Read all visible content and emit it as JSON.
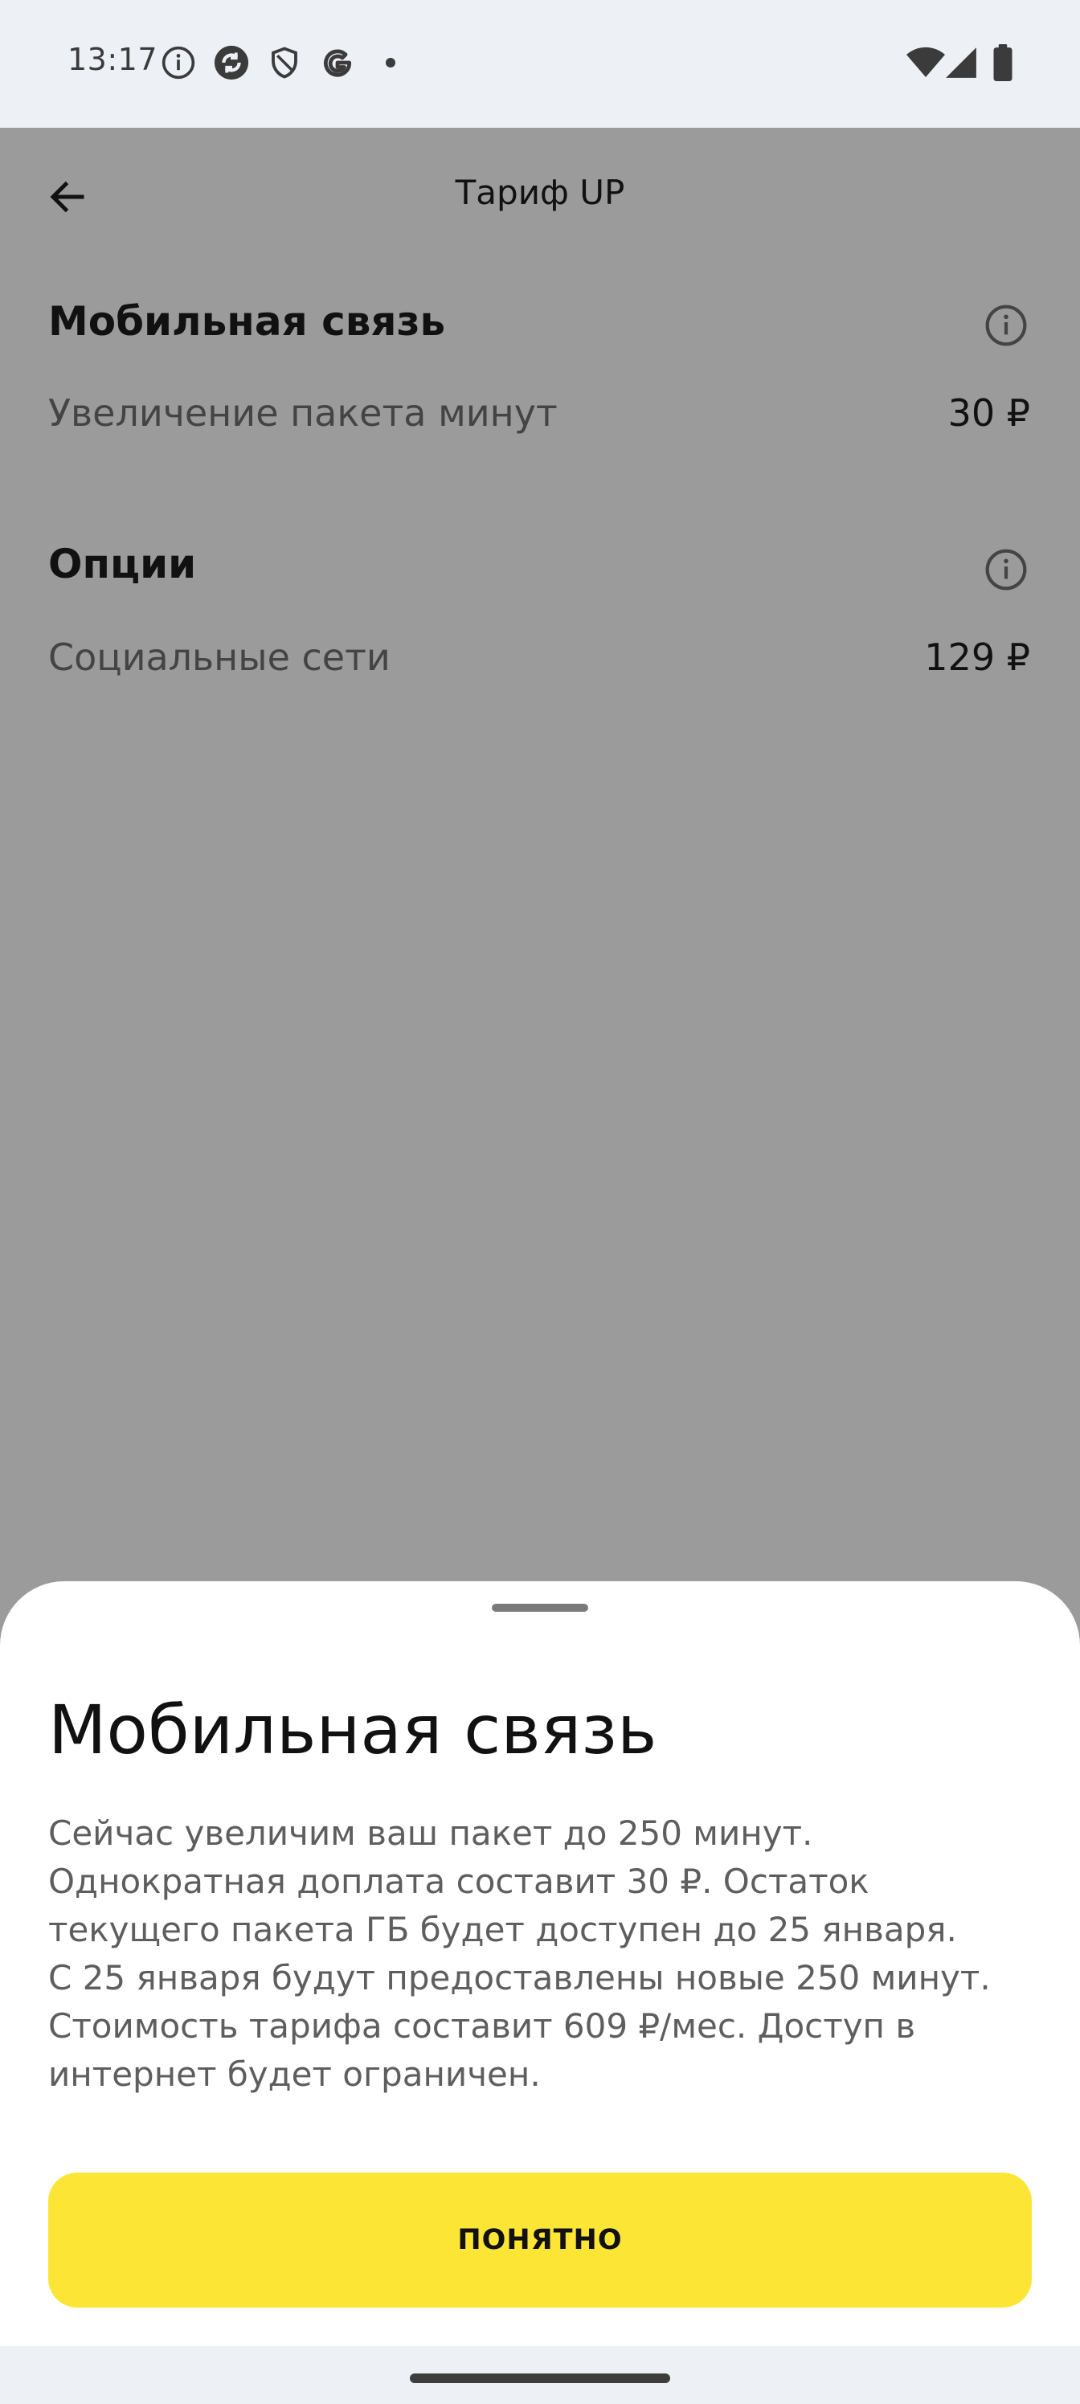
{
  "status_bar": {
    "time": "13:17",
    "left_icons": [
      "info-icon",
      "sync-icon",
      "shield-icon",
      "google-icon",
      "dot-icon"
    ],
    "right_icons": [
      "wifi-icon",
      "cell-signal-icon",
      "battery-icon"
    ]
  },
  "app_bar": {
    "title": "Тариф UP",
    "back_icon": "arrow-back-icon"
  },
  "sections": [
    {
      "heading": "Мобильная связь",
      "info_icon": "info-icon",
      "row": {
        "label": "Увеличение пакета минут",
        "price": "30 ₽"
      }
    },
    {
      "heading": "Опции",
      "info_icon": "info-icon",
      "row": {
        "label": "Социальные сети",
        "price": "129 ₽"
      }
    }
  ],
  "sheet": {
    "title": "Мобильная связь",
    "body": [
      "Сейчас увеличим ваш пакет до 250 минут. Однократная доплата составит 30 ₽. Остаток текущего пакета ГБ будет доступен до 25 января.",
      "С 25 января будут предоставлены новые 250 минут. Стоимость тарифа составит 609 ₽/мес. Доступ в интернет будет ограничен."
    ],
    "button_label": "ПОНЯТНО"
  },
  "colors": {
    "accent": "#fde535",
    "scrim": "#9b9b9b",
    "system_bar": "#edf1f5"
  }
}
